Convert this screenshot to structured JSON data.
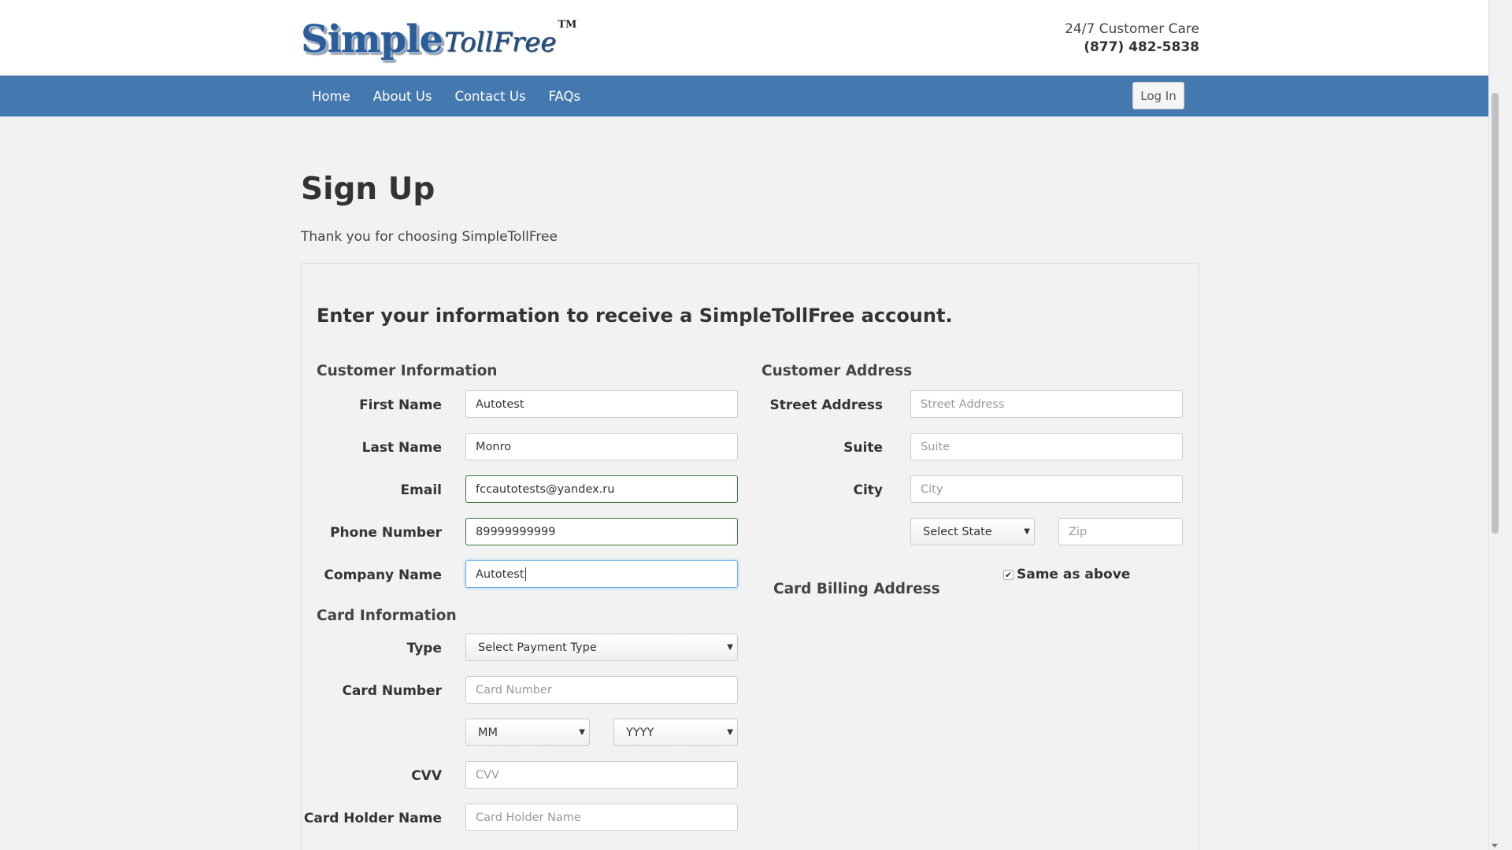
{
  "header": {
    "logo_main": "Simple",
    "logo_sub": "TollFree",
    "logo_tm": "TM",
    "care_label": "24/7 Customer Care",
    "care_phone": "(877) 482-5838"
  },
  "nav": {
    "items": [
      "Home",
      "About Us",
      "Contact Us",
      "FAQs"
    ],
    "login_label": "Log In"
  },
  "page": {
    "title": "Sign Up",
    "thanks": "Thank you for choosing SimpleTollFree",
    "panel_heading": "Enter your information to receive a SimpleTollFree account."
  },
  "customer_info": {
    "title": "Customer Information",
    "first_name": {
      "label": "First Name",
      "value": "Autotest"
    },
    "last_name": {
      "label": "Last Name",
      "value": "Monro"
    },
    "email": {
      "label": "Email",
      "value": "fccautotests@yandex.ru"
    },
    "phone": {
      "label": "Phone Number",
      "value": "89999999999"
    },
    "company": {
      "label": "Company Name",
      "value": "Autotest"
    }
  },
  "card_info": {
    "title": "Card Information",
    "type": {
      "label": "Type",
      "value": "Select Payment Type"
    },
    "card_number": {
      "label": "Card Number",
      "placeholder": "Card Number"
    },
    "month": {
      "value": "MM"
    },
    "year": {
      "value": "YYYY"
    },
    "cvv": {
      "label": "CVV",
      "placeholder": "CVV"
    },
    "holder": {
      "label": "Card Holder Name",
      "placeholder": "Card Holder Name"
    }
  },
  "customer_address": {
    "title": "Customer Address",
    "street": {
      "label": "Street Address",
      "placeholder": "Street Address"
    },
    "suite": {
      "label": "Suite",
      "placeholder": "Suite"
    },
    "city": {
      "label": "City",
      "placeholder": "City"
    },
    "state": {
      "value": "Select State"
    },
    "zip": {
      "placeholder": "Zip"
    }
  },
  "billing": {
    "title": "Card Billing Address",
    "same_as_above_label": "Same as above",
    "same_as_above_checked": true
  },
  "colors": {
    "nav_bg": "#4479b0",
    "page_bg": "#f2f2f2",
    "valid_border": "#3c763d",
    "focus_border": "#66afe9"
  }
}
